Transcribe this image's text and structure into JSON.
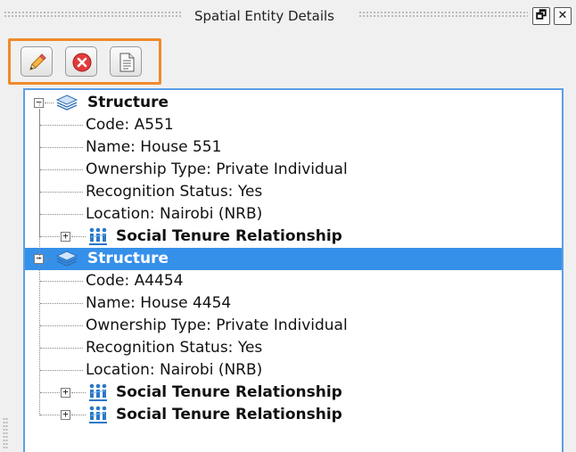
{
  "panel": {
    "title": "Spatial Entity Details",
    "float_glyph": "🗗",
    "close_glyph": "✕"
  },
  "toolbar": {
    "buttons": [
      {
        "name": "edit-button",
        "icon": "pencil-icon"
      },
      {
        "name": "remove-button",
        "icon": "cancel-icon"
      },
      {
        "name": "view-document-button",
        "icon": "document-icon"
      }
    ],
    "highlight_color": "#f08a2c"
  },
  "colors": {
    "selection": "#3590ea",
    "tree_border": "#5c9ee6"
  },
  "tree": {
    "entities": [
      {
        "label": "Structure",
        "expanded": true,
        "selected": false,
        "fields": [
          "Code: A551",
          "Name: House 551",
          "Ownership Type: Private Individual",
          "Recognition Status: Yes",
          "Location: Nairobi (NRB)"
        ],
        "relationships": [
          "Social Tenure Relationship"
        ]
      },
      {
        "label": "Structure",
        "expanded": true,
        "selected": true,
        "fields": [
          "Code: A4454",
          "Name: House 4454",
          "Ownership Type: Private Individual",
          "Recognition Status: Yes",
          "Location: Nairobi (NRB)"
        ],
        "relationships": [
          "Social Tenure Relationship",
          "Social Tenure Relationship"
        ]
      }
    ]
  }
}
